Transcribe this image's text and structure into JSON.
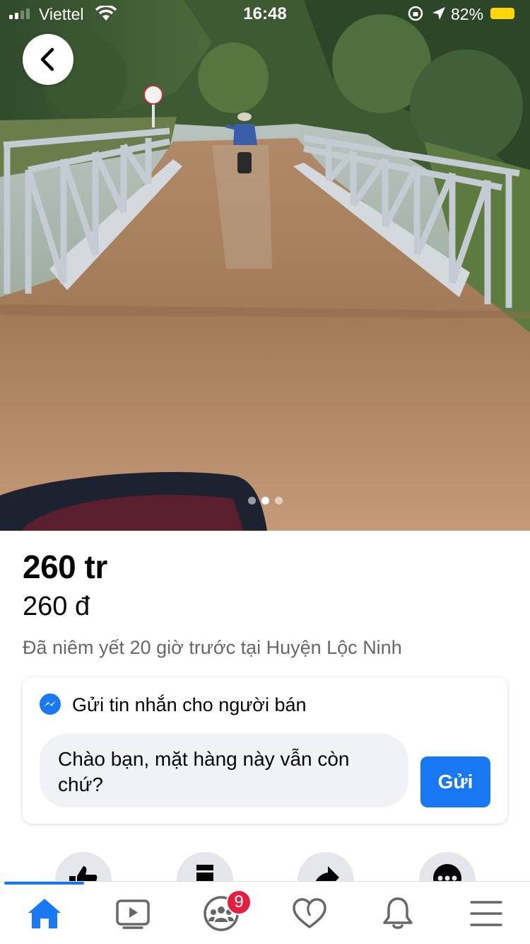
{
  "status_bar": {
    "carrier": "Viettel",
    "time": "16:48",
    "battery_percent": "82%"
  },
  "photo": {
    "image_index": 2,
    "image_count": 3
  },
  "listing": {
    "price": "260 tr",
    "price_detail": "260 đ",
    "listed_info": "Đã niêm yết 20 giờ trước tại Huyện Lộc Ninh"
  },
  "message_card": {
    "title": "Gửi tin nhắn cho người bán",
    "input_value": "Chào bạn, mặt hàng này vẫn còn chứ?",
    "send_label": "Gửi"
  },
  "action_icons": [
    "like-icon",
    "save-icon",
    "share-icon",
    "more-icon"
  ],
  "tab_bar": {
    "tabs": [
      "home-icon",
      "watch-icon",
      "groups-icon",
      "dating-icon",
      "notifications-icon",
      "menu-icon"
    ],
    "active_tab": "home-icon",
    "groups_badge": "9"
  },
  "colors": {
    "accent": "#1877f2",
    "badge": "#e41e3f",
    "secondary_text": "#65676b"
  }
}
